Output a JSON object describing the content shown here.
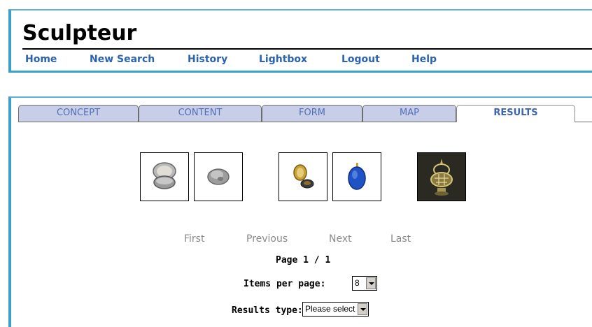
{
  "app": {
    "title": "Sculpteur"
  },
  "nav": {
    "items": [
      {
        "label": "Home"
      },
      {
        "label": "New Search"
      },
      {
        "label": "History"
      },
      {
        "label": "Lightbox"
      },
      {
        "label": "Logout"
      },
      {
        "label": "Help"
      }
    ]
  },
  "tabs": [
    {
      "label": "CONCEPT"
    },
    {
      "label": "CONTENT"
    },
    {
      "label": "FORM"
    },
    {
      "label": "MAP"
    },
    {
      "label": "RESULTS",
      "active": true
    }
  ],
  "results": {
    "thumbnails": [
      {
        "name": "silver-box-open"
      },
      {
        "name": "silver-box-closed"
      },
      {
        "name": "gold-locket-open"
      },
      {
        "name": "blue-locket"
      },
      {
        "name": "ornate-gold-vessel"
      }
    ],
    "pager": {
      "first": "First",
      "previous": "Previous",
      "next": "Next",
      "last": "Last"
    },
    "page_info": "Page 1 / 1",
    "items_per_page_label": "Items per page:",
    "items_per_page_value": "8",
    "results_type_label": "Results type:",
    "results_type_value": "Please select"
  },
  "colors": {
    "accent": "#3aa0c8",
    "link": "#2b62b3",
    "tab_bg": "#c9cee8"
  }
}
